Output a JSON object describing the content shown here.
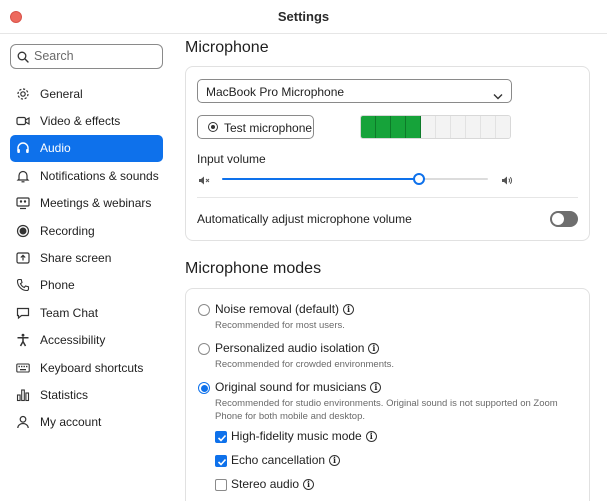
{
  "window": {
    "title": "Settings"
  },
  "search": {
    "placeholder": "Search"
  },
  "sidebar": {
    "items": [
      {
        "label": "General",
        "icon": "gear-icon"
      },
      {
        "label": "Video & effects",
        "icon": "video-camera-icon"
      },
      {
        "label": "Audio",
        "icon": "headphones-icon",
        "active": true
      },
      {
        "label": "Notifications & sounds",
        "icon": "bell-icon"
      },
      {
        "label": "Meetings & webinars",
        "icon": "meetings-icon"
      },
      {
        "label": "Recording",
        "icon": "record-icon"
      },
      {
        "label": "Share screen",
        "icon": "share-screen-icon"
      },
      {
        "label": "Phone",
        "icon": "phone-icon"
      },
      {
        "label": "Team Chat",
        "icon": "chat-icon"
      },
      {
        "label": "Accessibility",
        "icon": "accessibility-icon"
      },
      {
        "label": "Keyboard shortcuts",
        "icon": "keyboard-icon"
      },
      {
        "label": "Statistics",
        "icon": "statistics-icon"
      },
      {
        "label": "My account",
        "icon": "user-icon"
      }
    ]
  },
  "microphone": {
    "heading": "Microphone",
    "device": "MacBook Pro Microphone",
    "test_button": "Test microphone",
    "meter": {
      "segments": 10,
      "active": 4
    },
    "input_volume_label": "Input volume",
    "input_volume_fraction": 0.74,
    "auto_adjust_label": "Automatically adjust microphone volume",
    "auto_adjust_on": false
  },
  "modes": {
    "heading": "Microphone modes",
    "options": [
      {
        "label": "Noise removal (default)",
        "desc": "Recommended for most users.",
        "selected": false
      },
      {
        "label": "Personalized audio isolation",
        "desc": "Recommended for crowded environments.",
        "selected": false
      },
      {
        "label": "Original sound for musicians",
        "desc": "Recommended for studio environments. Original sound is not supported on Zoom Phone for both mobile and desktop.",
        "selected": true
      }
    ],
    "musician_options": [
      {
        "label": "High-fidelity music mode",
        "checked": true
      },
      {
        "label": "Echo cancellation",
        "checked": true
      },
      {
        "label": "Stereo audio",
        "checked": false
      }
    ]
  },
  "colors": {
    "accent": "#0e71eb",
    "meter_on": "#16a33a",
    "toggle_off": "#6e6e6e"
  }
}
